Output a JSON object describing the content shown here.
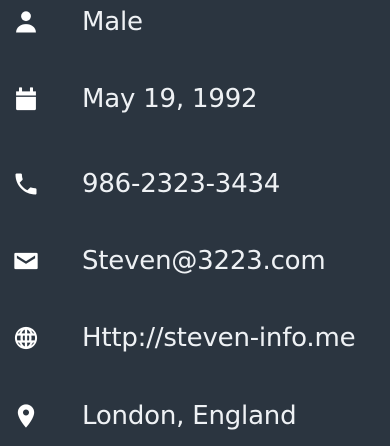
{
  "profile": {
    "items": [
      {
        "icon": "person-icon",
        "text": "Male"
      },
      {
        "icon": "calendar-icon",
        "text": "May 19, 1992"
      },
      {
        "icon": "phone-icon",
        "text": "986-2323-3434"
      },
      {
        "icon": "email-icon",
        "text": "Steven@3223.com"
      },
      {
        "icon": "globe-icon",
        "text": "Http://steven-info.me"
      },
      {
        "icon": "location-pin-icon",
        "text": "London, England"
      }
    ]
  },
  "colors": {
    "background": "#2b3540",
    "text": "#eef1f4",
    "icon": "#ffffff"
  }
}
